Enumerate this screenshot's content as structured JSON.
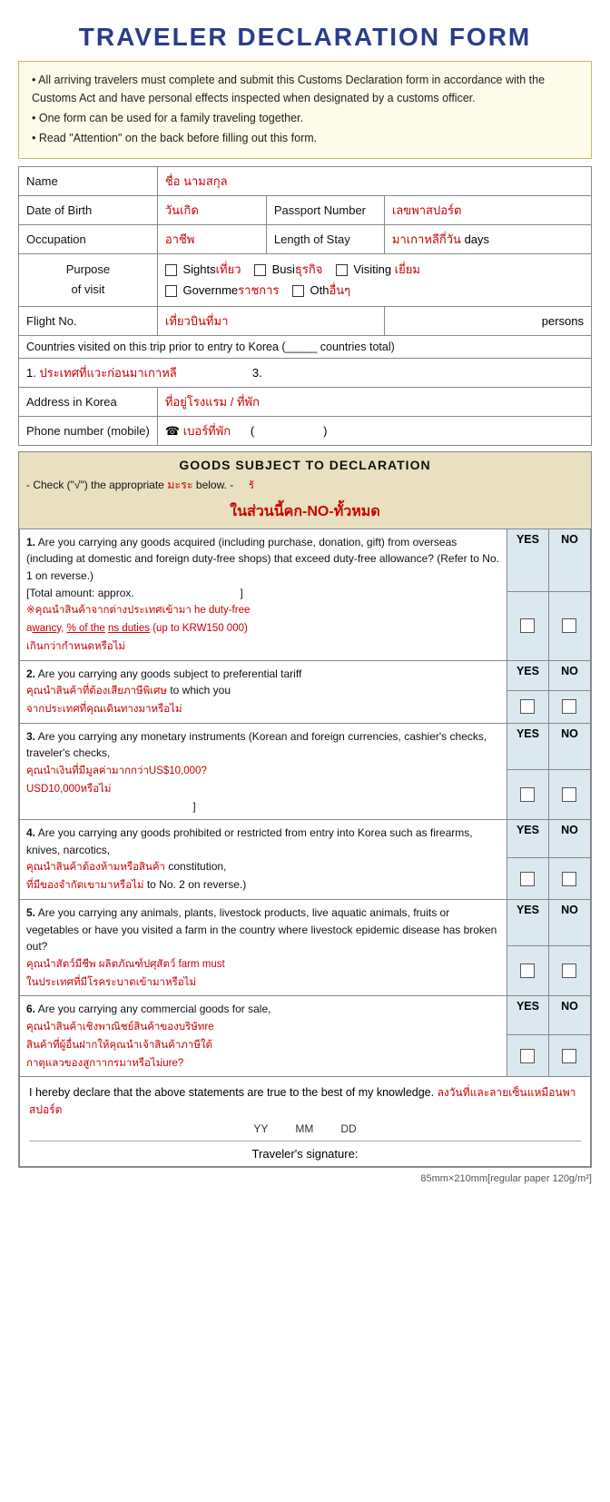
{
  "title": "TRAVELER  DECLARATION  FORM",
  "info": {
    "line1": "All arriving travelers must complete and submit this Customs Declaration form in accordance with the Customs Act and have personal effects inspected when designated by a customs officer.",
    "line2": "One form can be used for a family traveling together.",
    "line3": "Read \"Attention\" on the back before filling out this form."
  },
  "form": {
    "name_label": "Name",
    "name_thai": "ชื่อ  นามสกุล",
    "dob_label": "Date of Birth",
    "dob_thai": "วันเกิด",
    "passport_label": "Passport Number",
    "passport_thai": "เลขพาสปอร์ต",
    "occupation_label": "Occupation",
    "occupation_thai": "อาชีพ",
    "stay_label": "Length of Stay",
    "stay_thai": "มาเกาหลีกี่วัน",
    "stay_unit": "days",
    "purpose_label": "Purpose\nof visit",
    "purpose_options": [
      {
        "check": "□",
        "text": "Sights",
        "thai": "เที่ยว"
      },
      {
        "check": "□",
        "text": "Busi",
        "thai": "ธุรกิจ"
      },
      {
        "check": "□",
        "text": "Visiting",
        "thai": "เยี่ยม"
      },
      {
        "check": "□",
        "text": "Governme",
        "thai": "ราชการ"
      },
      {
        "check": "□",
        "text": "Oth",
        "thai": "อื่นๆ"
      }
    ],
    "flight_label": "Flight No.",
    "flight_thai": "เที่ยวบินที่มา",
    "flight_persons": "persons",
    "countries_label": "Countries visited on this trip prior to entry to Korea (_____ countries total)",
    "country1_thai": "ประเทศที่แวะก่อนมาเกาหลี",
    "country1_num": "1.",
    "country3_num": "3.",
    "address_label": "Address in Korea",
    "address_thai": "ที่อยู่โรงแรม / ที่พัก",
    "phone_label": "Phone number (mobile)",
    "phone_icon": "☎",
    "phone_thai": "เบอร์ที่พัก",
    "phone_paren_open": "(",
    "phone_paren_close": ")"
  },
  "goods": {
    "header": "GOODS  SUBJECT  TO  DECLARATION",
    "subheader": "- Check (\"√\") the appropriate",
    "subheader2": "below. -",
    "no_header_thai": "ในส่วนนี้คก-NO-ทั้วหมด",
    "items": [
      {
        "number": "1.",
        "text": "Are you carrying any goods acquired (including purchase, donation, gift) from overseas (including at domestic and foreign duty-free shops) that exceed duty-free allowance? (Refer to No. 1 on reverse.)\n[Total amount: approx.                              ]",
        "thai": "※คุณนำสินค้าจากต่างประเทศเข้ามา\nเกิน​ว่ากว่ากำหนดหรือไม่",
        "thai2": "เกิน​กว่า​กำหนด​หรือไม่",
        "yes": "YES",
        "no": "NO"
      },
      {
        "number": "2.",
        "text": "Are you carrying any goods subject to preferential tariff",
        "thai": "คุณนำสินค้าที่ตัวเสียภาษีพิเศษ to which you\nจากประเทศที่คุณเดินทางมาหรือไม่",
        "yes": "YES",
        "no": "NO"
      },
      {
        "number": "3.",
        "text": "Are you carrying any monetary instruments (Korean and foreign currencies, cashier's checks, traveler's checks,",
        "thai": "คุณนำเงินที่มีมูลค่ามากกว่าUS$10,000?\nUS$10,000หรือไม่",
        "yes": "YES",
        "no": "NO"
      },
      {
        "number": "4.",
        "text": "Are you carrying any goods prohibited or restricted from entry into Korea such as firearms, knives, narcotics,",
        "thai": "คุณนำสินค้าต้องหามหรือสินค้า constitution,\nที่มีของจำกัดเขามาหรือไม่ to No. 2 on reverse.)",
        "yes": "YES",
        "no": "NO"
      },
      {
        "number": "5.",
        "text": "Are you carrying any animals, plants, livestock products, live aquatic animals, fruits or vegetables or have you visited a farm in the country where livestock epidemic disease has broken out?",
        "thai": "คุณนำสัตว์มีชีพ ผลิตภัณฑ์ปศุสัตว์ farm must\nในประเทศที่มีโรคระบาดเข้ามาหรือไม่",
        "yes": "YES",
        "no": "NO"
      },
      {
        "number": "6.",
        "text": "Are you carrying any commercial goods for sale,",
        "thai": "คุณนำสินค้าเชิงพาณิชย์สินค้าของบริษัทre\nสินค้าที่ผู้อื่นฝากให้คุณนำเจ้าสินค้าภาษีใต้\nกาตุแล​ว​ของสูกาากร​มาหรือไม่ure?",
        "yes": "YES",
        "no": "NO"
      }
    ]
  },
  "signature": {
    "text": "I hereby declare that the above statements are true to the best of my knowledge.",
    "thai": "ลงวันที่และลายเซ็นแหมือนพาสปอร์ต",
    "yy": "YY",
    "mm": "MM",
    "dd": "DD",
    "traveler": "Traveler's signature:"
  },
  "paper_size": "85mm×210mm[regular paper 120g/m²]"
}
